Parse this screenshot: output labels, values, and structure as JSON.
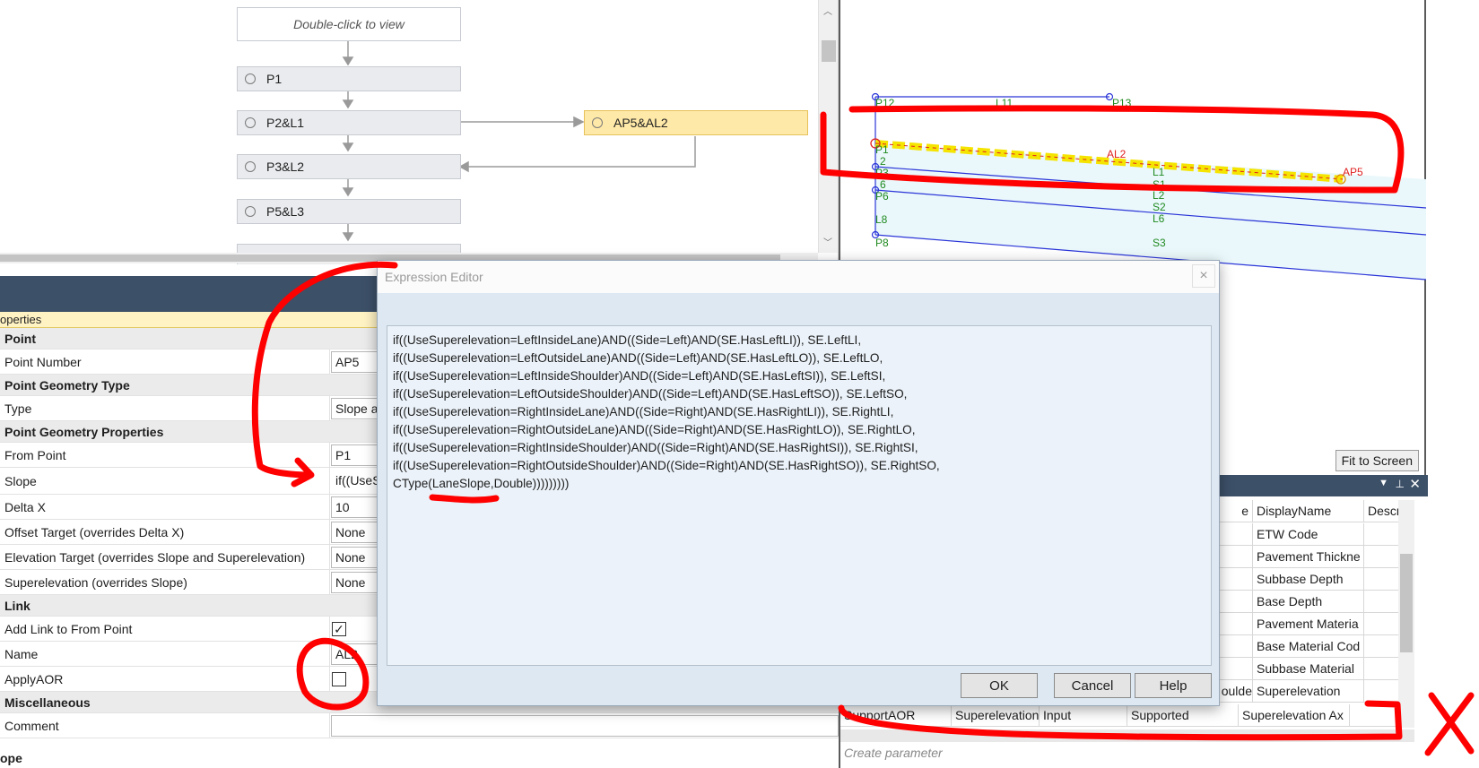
{
  "flow": {
    "double_click": "Double-click to view",
    "nodes": [
      "P1",
      "P2&L1",
      "P3&L2",
      "P5&L3"
    ],
    "side_node": "AP5&AL2"
  },
  "preview": {
    "labels": [
      "P12",
      "L11",
      "P13",
      "P1",
      "2",
      "P3",
      "6",
      "P6",
      "L8",
      "P8",
      "AL2",
      "L1",
      "S1",
      "L2",
      "S2",
      "L6",
      "S3",
      "AP5"
    ],
    "fit_button": "Fit to Screen"
  },
  "properties": {
    "header": "operties",
    "rows": {
      "cat_point": "Point",
      "point_number_label": "Point Number",
      "point_number_value": "AP5",
      "cat_geom_type": "Point Geometry Type",
      "type_label": "Type",
      "type_value": "Slope a",
      "cat_geom_props": "Point Geometry Properties",
      "from_point_label": "From Point",
      "from_point_value": "P1",
      "slope_label": "Slope",
      "slope_value": "if((UseS",
      "delta_x_label": "Delta X",
      "delta_x_value": "10",
      "offset_label": "Offset Target (overrides Delta X)",
      "offset_value": "None",
      "elev_label": "Elevation Target (overrides Slope and Superelevation)",
      "elev_value": "None",
      "super_label": "Superelevation (overrides Slope)",
      "super_value": "None",
      "cat_link": "Link",
      "add_link_label": "Add Link to From Point",
      "name_label": "Name",
      "name_value": "AL2",
      "applyaor_label": "ApplyAOR",
      "cat_misc": "Miscellaneous",
      "comment_label": "Comment"
    },
    "footer": "ope"
  },
  "dialog": {
    "title": "Expression Editor",
    "close": "×",
    "expression_lines": [
      "if((UseSuperelevation=LeftInsideLane)AND((Side=Left)AND(SE.HasLeftLI)), SE.LeftLI,",
      "if((UseSuperelevation=LeftOutsideLane)AND((Side=Left)AND(SE.HasLeftLO)), SE.LeftLO,",
      "if((UseSuperelevation=LeftInsideShoulder)AND((Side=Left)AND(SE.HasLeftSI)), SE.LeftSI,",
      "if((UseSuperelevation=LeftOutsideShoulder)AND((Side=Left)AND(SE.HasLeftSO)), SE.LeftSO,",
      "if((UseSuperelevation=RightInsideLane)AND((Side=Right)AND(SE.HasRightLI)), SE.RightLI,",
      "if((UseSuperelevation=RightOutsideLane)AND((Side=Right)AND(SE.HasRightLO)), SE.RightLO,",
      "if((UseSuperelevation=RightInsideShoulder)AND((Side=Right)AND(SE.HasRightSI)), SE.RightSI,",
      "if((UseSuperelevation=RightOutsideShoulder)AND((Side=Right)AND(SE.HasRightSO)), SE.RightSO,",
      "CType(LaneSlope,Double)))))))))"
    ],
    "ok": "OK",
    "cancel": "Cancel",
    "help": "Help"
  },
  "params": {
    "col_display": "DisplayName",
    "col_descr": "Descrip",
    "col_e": "e",
    "display_names": [
      "ETW Code",
      "Pavement Thickne",
      "Subbase Depth",
      "Base Depth",
      "Pavement Materia",
      "Base Material Cod",
      "Subbase Material",
      "Superelevation",
      "Superelevation Ax"
    ],
    "shoulder_fragment": "oulde",
    "last_row": [
      "SupportAOR",
      "Superelevation",
      "Input",
      "Supported"
    ],
    "create_param": "Create parameter"
  }
}
